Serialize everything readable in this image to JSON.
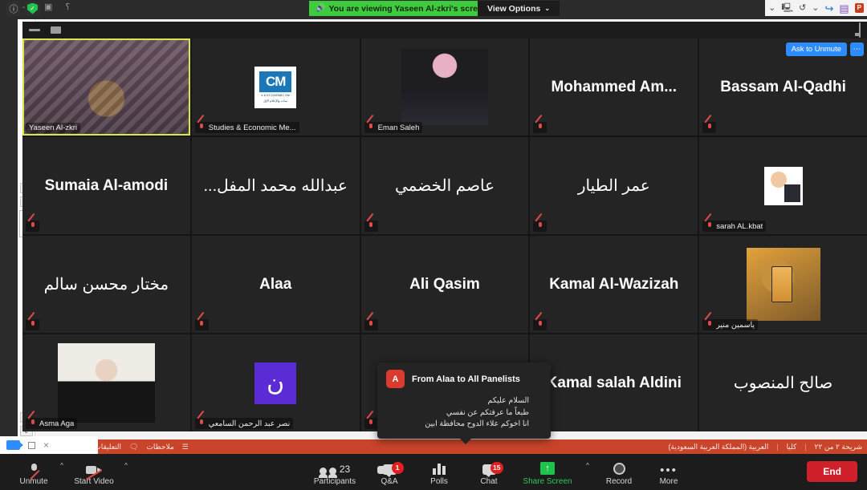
{
  "top_bar": {
    "info_icon": "info-icon",
    "shield_icon": "security-shield-icon",
    "share_banner": "You are viewing Yaseen Al-zkri's screen",
    "speaker_icon": "speaker-icon",
    "view_options_label": "View Options",
    "view_options_chevron": "⌄"
  },
  "view_modes": {
    "minimize": "minimize-view",
    "single": "single-speaker-view",
    "split": "split-view",
    "grid": "gallery-grid-view",
    "pip": "picture-in-picture"
  },
  "gallery": {
    "next_page_icon": "›",
    "tiles": [
      {
        "name": "Yaseen Al-zkri",
        "display": "footer",
        "muted": false,
        "active": true,
        "media": "video-yaseen"
      },
      {
        "name": "Studies & Economic Me...",
        "display": "footer",
        "muted": true,
        "active": false,
        "media": "logo-sem",
        "logo_text": "s & ECONOMIC Me",
        "logo_caption_ar": "سات والإعلام الإق"
      },
      {
        "name": "Eman Saleh",
        "display": "footer",
        "muted": true,
        "active": false,
        "media": "video-eman"
      },
      {
        "name": "Mohammed  Am...",
        "display": "center",
        "muted": true,
        "active": false,
        "media": "none"
      },
      {
        "name": "Bassam Al-Qadhi",
        "display": "center",
        "muted": true,
        "active": false,
        "media": "none",
        "ask_to_unmute": "Ask to Unmute",
        "more": "⋯"
      },
      {
        "name": "Sumaia Al-amodi",
        "display": "center",
        "muted": true,
        "active": false,
        "media": "none"
      },
      {
        "name": "عبدالله محمد المفل...",
        "display": "center",
        "rtl": true,
        "muted": false,
        "active": false,
        "media": "none"
      },
      {
        "name": "عاصم الخضمي",
        "display": "center",
        "rtl": true,
        "muted": true,
        "active": false,
        "media": "none"
      },
      {
        "name": "عمر الطيار",
        "display": "center",
        "rtl": true,
        "muted": true,
        "active": false,
        "media": "none"
      },
      {
        "name": "sarah AL.kbat",
        "display": "footer",
        "muted": true,
        "active": false,
        "media": "avatar-sarah"
      },
      {
        "name": "مختار محسن سالم",
        "display": "center",
        "rtl": true,
        "muted": true,
        "active": false,
        "media": "none"
      },
      {
        "name": "Alaa",
        "display": "center",
        "muted": true,
        "active": false,
        "media": "none"
      },
      {
        "name": "Ali Qasim",
        "display": "center",
        "muted": true,
        "active": false,
        "media": "none"
      },
      {
        "name": "Kamal Al-Wazizah",
        "display": "center",
        "muted": true,
        "active": false,
        "media": "none"
      },
      {
        "name": "ياسمين منير",
        "display": "footer",
        "rtl": true,
        "muted": true,
        "active": false,
        "media": "video-yasmin"
      },
      {
        "name": "Asma Aga",
        "display": "footer",
        "muted": true,
        "active": false,
        "media": "video-asma"
      },
      {
        "name": "نصر عبد الرحمن السامعي",
        "display": "footer",
        "rtl": true,
        "muted": true,
        "active": false,
        "media": "letter-avatar",
        "letter": "ن"
      },
      {
        "name": "",
        "display": "footer",
        "muted": true,
        "active": false,
        "media": "none"
      },
      {
        "name": "Kamal salah Aldini",
        "display": "center",
        "muted": false,
        "active": false,
        "media": "none"
      },
      {
        "name": "صالح المنصوب",
        "display": "center",
        "rtl": true,
        "muted": false,
        "active": false,
        "media": "none"
      }
    ]
  },
  "chat_toast": {
    "avatar_letter": "A",
    "title": "From Alaa to All Panelists",
    "lines": [
      "السلام عليكم",
      "طبعاً ما عرفتكم عن نفسي",
      "انا اخوكم علاء الدوح محافظة ابين"
    ]
  },
  "toolbar": {
    "unmute": {
      "label": "Unmute",
      "icon": "mic-muted-icon",
      "caret": "^"
    },
    "start_video": {
      "label": "Start Video",
      "icon": "camera-off-icon",
      "caret": "^"
    },
    "participants": {
      "label": "Participants",
      "icon": "people-icon",
      "count": "23"
    },
    "qa": {
      "label": "Q&A",
      "icon": "chat-bubbles-icon",
      "badge": "1"
    },
    "polls": {
      "label": "Polls",
      "icon": "bar-chart-icon"
    },
    "chat": {
      "label": "Chat",
      "icon": "chat-bubble-icon",
      "badge": "15"
    },
    "share_screen": {
      "label": "Share Screen",
      "icon": "share-arrow-up-icon",
      "caret": "^"
    },
    "record": {
      "label": "Record",
      "icon": "record-circle-icon"
    },
    "more": {
      "label": "More",
      "icon": "ellipsis-icon"
    },
    "end": {
      "label": "End"
    }
  },
  "powerpoint": {
    "status_slide": "شريحة ٢ من ٢٢",
    "status_language": "العربية (المملكة العربية السعودية)",
    "status_spell": "كليا",
    "notes_label": "ملاحظات",
    "comments_label": "التعليقات",
    "quick_access": {
      "save_icon": "save-icon",
      "redo_icon": "redo-icon",
      "undo_icon": "undo-icon",
      "present_icon": "present-icon",
      "ppt_icon": "powerpoint-icon"
    }
  },
  "window_popup": {
    "zoom_icon": "zoom-video-icon",
    "restore_icon": "restore-window-icon",
    "close_icon": "×"
  },
  "colors": {
    "accent_blue": "#2d8cff",
    "share_green": "#3ecb3e",
    "end_red": "#d0212b",
    "badge_red": "#e02020",
    "ppt_orange": "#c8442a",
    "active_speaker": "#d8e84a"
  }
}
